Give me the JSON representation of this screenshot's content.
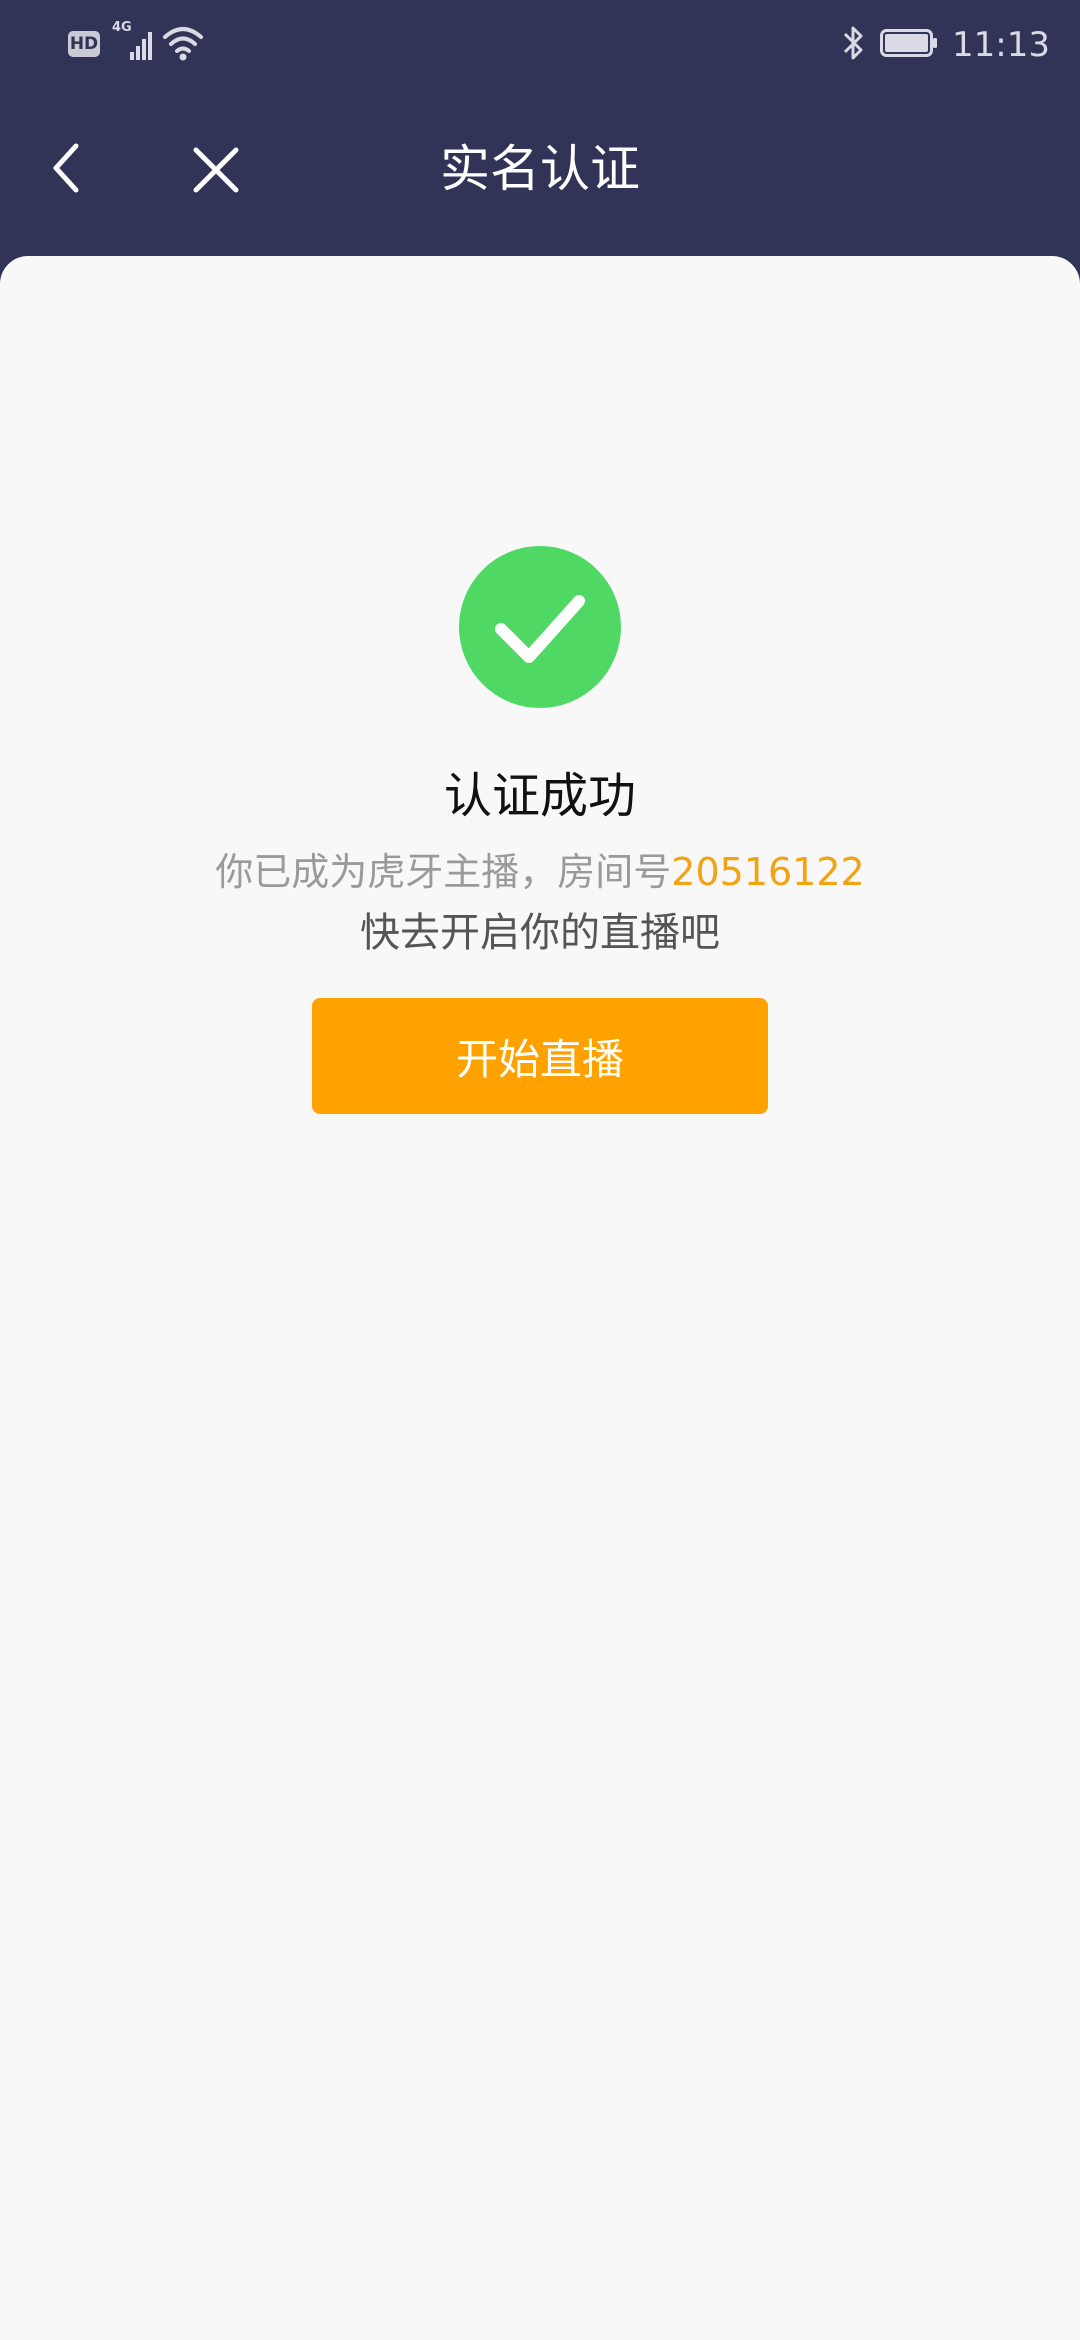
{
  "status_bar": {
    "hd_label": "HD",
    "network_label": "4G",
    "time": "11:13",
    "icons": [
      "hd-icon",
      "signal-4g-icon",
      "wifi-icon",
      "bluetooth-icon",
      "battery-icon"
    ]
  },
  "nav": {
    "title": "实名认证",
    "back_icon": "chevron-left-icon",
    "close_icon": "close-icon"
  },
  "content": {
    "success_icon": "check-circle-icon",
    "title": "认证成功",
    "line1_prefix": "你已成为虎牙主播，房间号",
    "room_number": "20516122",
    "line2": "快去开启你的直播吧",
    "button_label": "开始直播"
  },
  "colors": {
    "header_bg": "#323457",
    "card_bg": "#f8f8f8",
    "success_green": "#4fd964",
    "accent_orange": "#ffa200",
    "room_number_color": "#f2a313"
  }
}
